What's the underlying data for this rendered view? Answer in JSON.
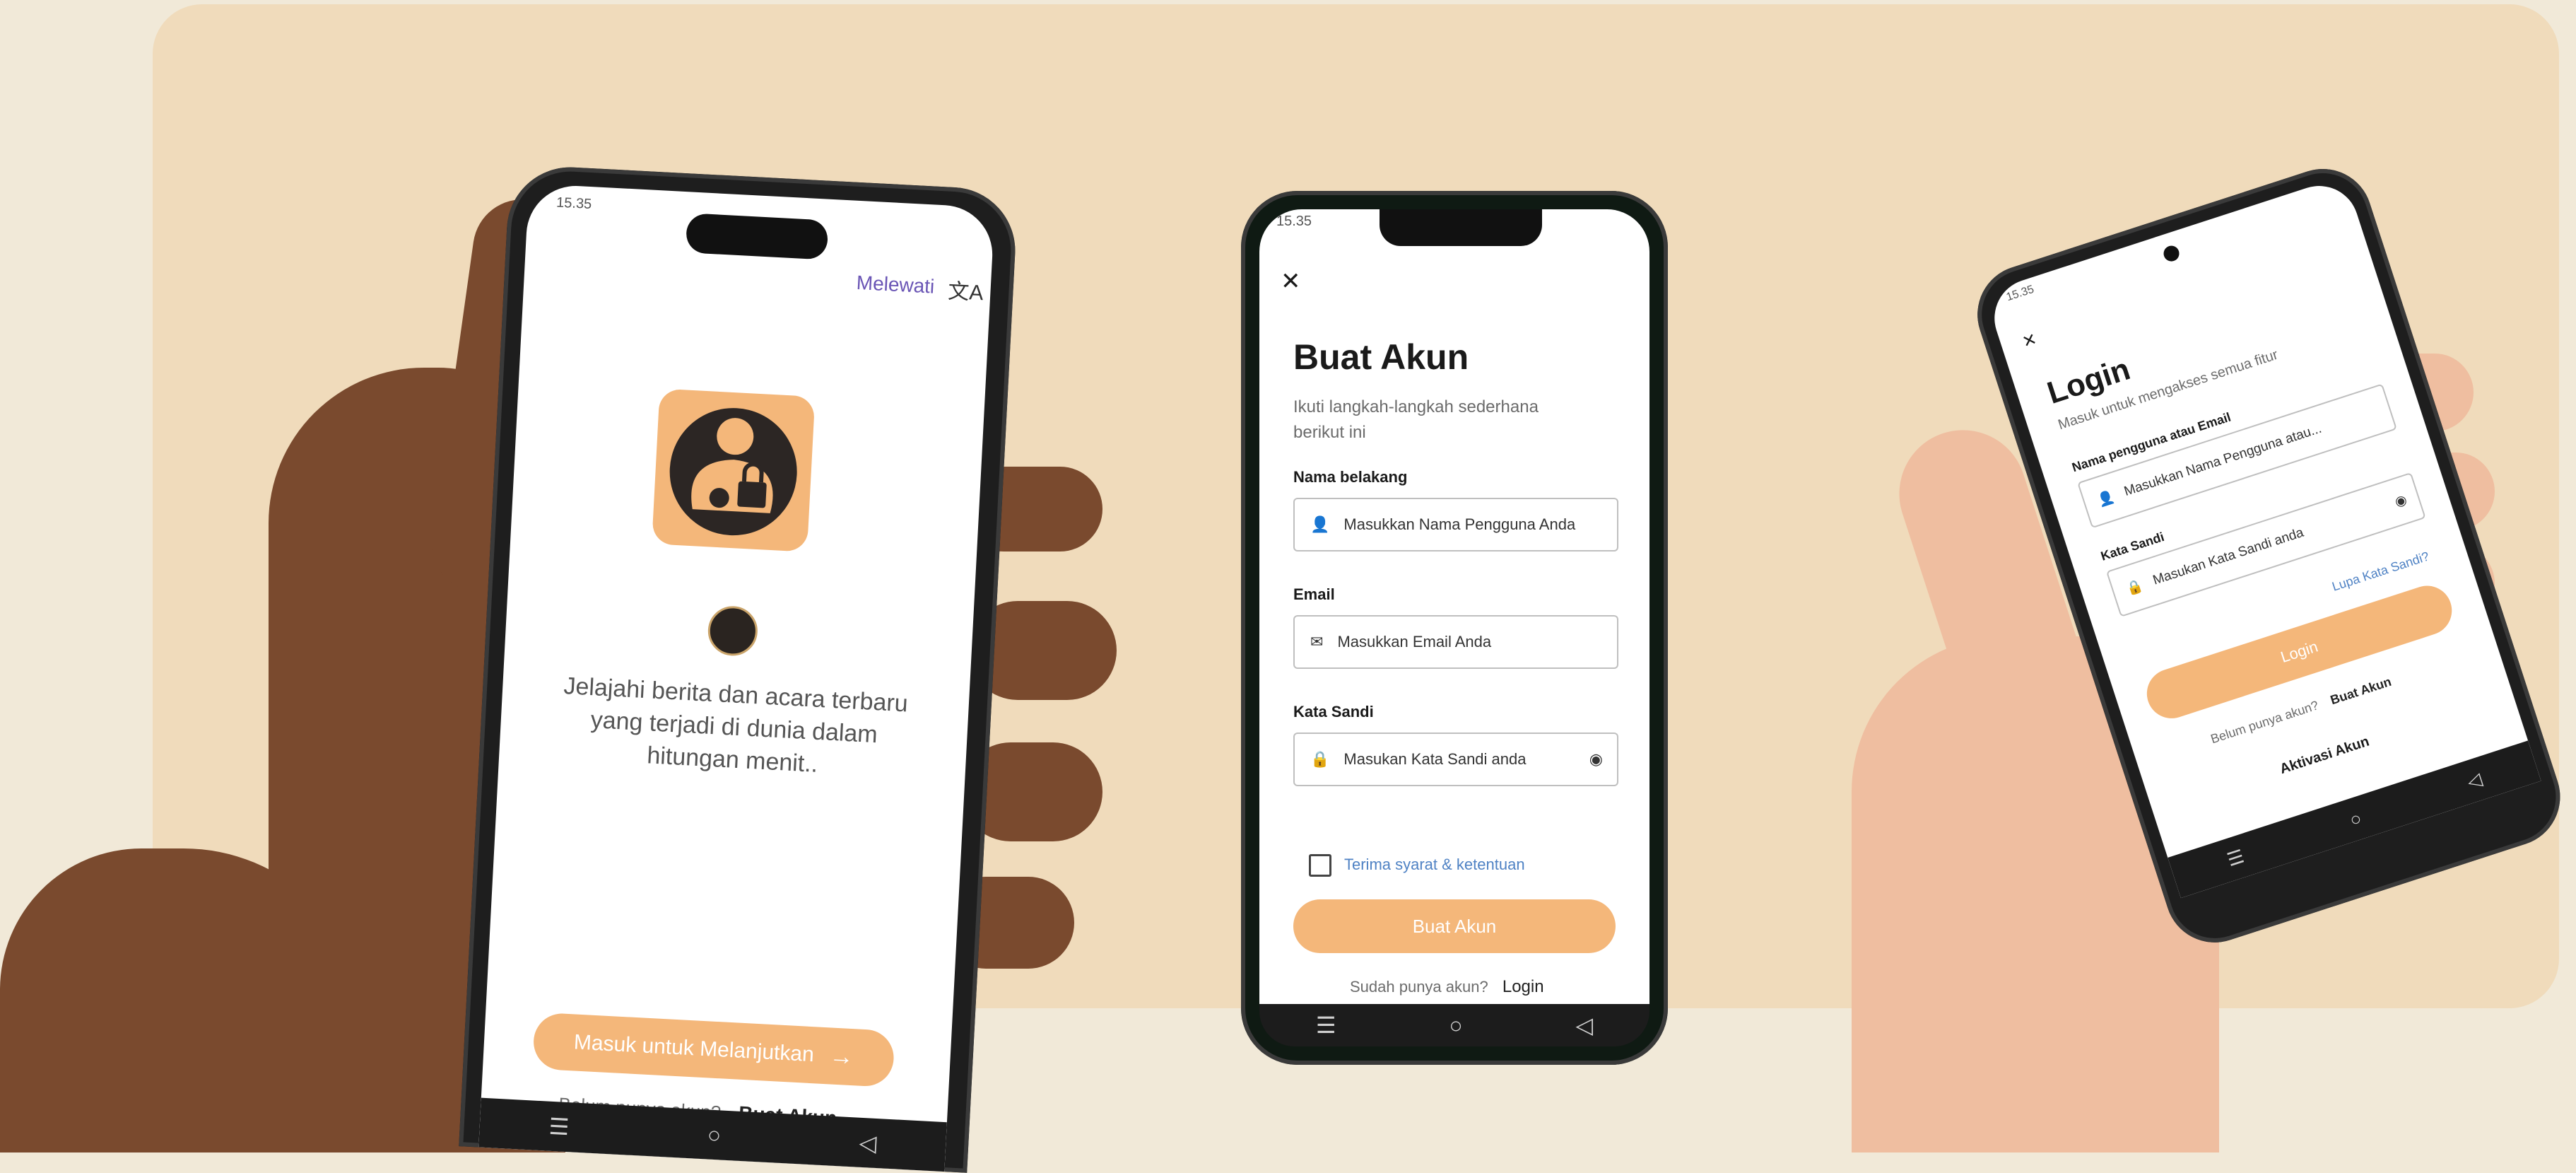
{
  "onboarding": {
    "status_time": "15.35",
    "skip_label": "Melewati",
    "translate_icon": "translate-icon",
    "description": "Jelajahi berita dan acara terbaru yang terjadi di dunia dalam hitungan menit..",
    "continue_label": "Masuk untuk Melanjutkan",
    "no_account_text": "Belum punya akun?",
    "create_account_label": "Buat Akun"
  },
  "register": {
    "status_time": "15.35",
    "title": "Buat Akun",
    "subtitle": "Ikuti langkah-langkah sederhana berikut ini",
    "name_label": "Nama belakang",
    "name_placeholder": "Masukkan Nama Pengguna Anda",
    "email_label": "Email",
    "email_placeholder": "Masukkan Email Anda",
    "password_label": "Kata Sandi",
    "password_placeholder": "Masukan Kata Sandi anda",
    "terms_label": "Terima syarat & ketentuan",
    "submit_label": "Buat Akun",
    "have_account_text": "Sudah punya akun?",
    "login_link": "Login"
  },
  "login": {
    "status_time": "15.35",
    "title": "Login",
    "subtitle": "Masuk untuk mengakses semua fitur",
    "user_label": "Nama pengguna atau Email",
    "user_placeholder": "Masukkan Nama Pengguna atau...",
    "password_label": "Kata Sandi",
    "password_placeholder": "Masukan Kata Sandi anda",
    "forgot_link": "Lupa Kata Sandi?",
    "submit_label": "Login",
    "no_account_text": "Belum punya akun?",
    "create_account_label": "Buat Akun",
    "activate_label": "Aktivasi Akun"
  },
  "nav_icons": [
    "menu-icon",
    "home-circle-icon",
    "back-triangle-icon"
  ],
  "colors": {
    "background": "#f1e9d8",
    "card": "#f0dbbb",
    "accent": "#f4b77a",
    "link": "#4f82c4",
    "skip_purple": "#6a55b5"
  }
}
